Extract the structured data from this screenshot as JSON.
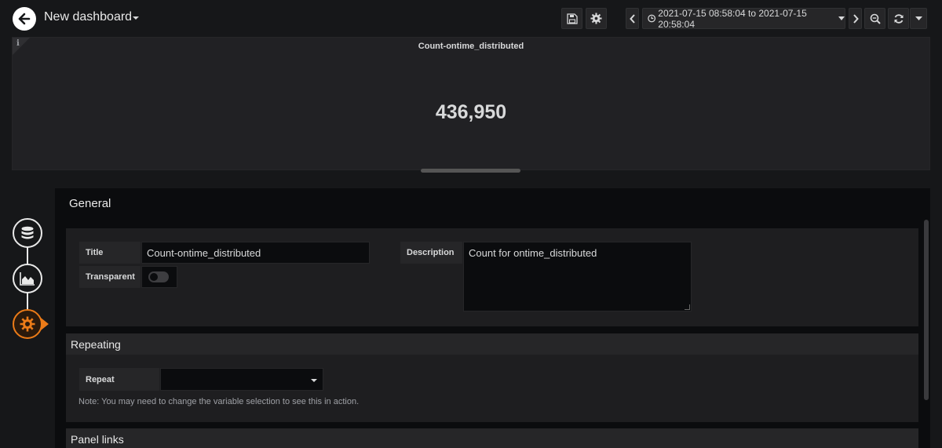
{
  "header": {
    "dashboard_title": "New dashboard",
    "time_range": "2021-07-15 08:58:04 to 2021-07-15 20:58:04",
    "icons": [
      "back-arrow-icon",
      "save-icon",
      "settings-gear-icon",
      "chevron-left-icon",
      "clock-icon",
      "chevron-right-icon",
      "zoom-out-icon",
      "refresh-icon",
      "caret-down-icon"
    ]
  },
  "panel": {
    "info_icon": "i",
    "title": "Count-ontime_distributed",
    "value": "436,950"
  },
  "rail": {
    "items": [
      "queries-database-icon",
      "visualization-chart-icon",
      "general-settings-icon"
    ],
    "active_color": "#eb7b18"
  },
  "general": {
    "heading": "General",
    "title_label": "Title",
    "title_value": "Count-ontime_distributed",
    "transparent_label": "Transparent",
    "transparent_on": false,
    "description_label": "Description",
    "description_value": "Count for ontime_distributed"
  },
  "repeating": {
    "heading": "Repeating",
    "repeat_label": "Repeat",
    "repeat_value": "",
    "note": "Note: You may need to change the variable selection to see this in action."
  },
  "panel_links": {
    "heading": "Panel links"
  }
}
